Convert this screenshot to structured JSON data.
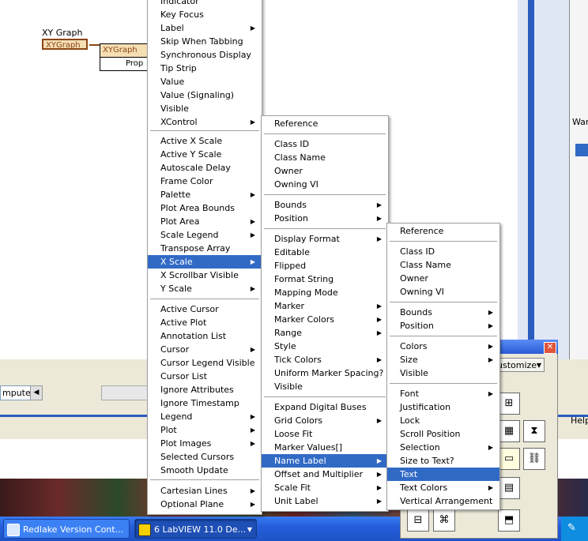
{
  "diagram": {
    "node_label": "XY Graph",
    "terminal_label": "XYGraph",
    "prop_node_top": "XYGraph",
    "prop_node_bottom": "Prop"
  },
  "right_frame": {
    "war_label": "War"
  },
  "lower_strip": {
    "computer_field": "mputer",
    "help_label": "Help"
  },
  "taskbar": {
    "task1": "Redlake Version Cont...",
    "task2": "6 LabVIEW 11.0 De..."
  },
  "palette": {
    "customize_label": "ustomize"
  },
  "menu1": {
    "items": [
      {
        "label": "Indicator",
        "sub": false
      },
      {
        "label": "Key Focus",
        "sub": false
      },
      {
        "label": "Label",
        "sub": true
      },
      {
        "label": "Skip When Tabbing",
        "sub": false
      },
      {
        "label": "Synchronous Display",
        "sub": false
      },
      {
        "label": "Tip Strip",
        "sub": false
      },
      {
        "label": "Value",
        "sub": false
      },
      {
        "label": "Value (Signaling)",
        "sub": false
      },
      {
        "label": "Visible",
        "sub": false
      },
      {
        "label": "XControl",
        "sub": true
      },
      {
        "label": "Active X Scale",
        "sub": false
      },
      {
        "label": "Active Y Scale",
        "sub": false
      },
      {
        "label": "Autoscale Delay",
        "sub": false
      },
      {
        "label": "Frame Color",
        "sub": false
      },
      {
        "label": "Palette",
        "sub": true
      },
      {
        "label": "Plot Area Bounds",
        "sub": false
      },
      {
        "label": "Plot Area",
        "sub": true
      },
      {
        "label": "Scale Legend",
        "sub": true
      },
      {
        "label": "Transpose Array",
        "sub": false
      },
      {
        "label": "X Scale",
        "sub": true
      },
      {
        "label": "X Scrollbar Visible",
        "sub": false
      },
      {
        "label": "Y Scale",
        "sub": true
      },
      {
        "label": "Active Cursor",
        "sub": false
      },
      {
        "label": "Active Plot",
        "sub": false
      },
      {
        "label": "Annotation List",
        "sub": false
      },
      {
        "label": "Cursor",
        "sub": true
      },
      {
        "label": "Cursor Legend Visible",
        "sub": false
      },
      {
        "label": "Cursor List",
        "sub": false
      },
      {
        "label": "Ignore Attributes",
        "sub": false
      },
      {
        "label": "Ignore Timestamp",
        "sub": false
      },
      {
        "label": "Legend",
        "sub": true
      },
      {
        "label": "Plot",
        "sub": true
      },
      {
        "label": "Plot Images",
        "sub": true
      },
      {
        "label": "Selected Cursors",
        "sub": false
      },
      {
        "label": "Smooth Update",
        "sub": false
      },
      {
        "label": "Cartesian Lines",
        "sub": true
      },
      {
        "label": "Optional Plane",
        "sub": true
      }
    ]
  },
  "menu2": {
    "items": [
      {
        "label": "Reference",
        "sub": false
      },
      {
        "label": "Class ID",
        "sub": false
      },
      {
        "label": "Class Name",
        "sub": false
      },
      {
        "label": "Owner",
        "sub": false
      },
      {
        "label": "Owning VI",
        "sub": false
      },
      {
        "label": "Bounds",
        "sub": true
      },
      {
        "label": "Position",
        "sub": true
      },
      {
        "label": "Display Format",
        "sub": true
      },
      {
        "label": "Editable",
        "sub": false
      },
      {
        "label": "Flipped",
        "sub": false
      },
      {
        "label": "Format String",
        "sub": false
      },
      {
        "label": "Mapping Mode",
        "sub": false
      },
      {
        "label": "Marker",
        "sub": true
      },
      {
        "label": "Marker Colors",
        "sub": true
      },
      {
        "label": "Range",
        "sub": true
      },
      {
        "label": "Style",
        "sub": false
      },
      {
        "label": "Tick Colors",
        "sub": true
      },
      {
        "label": "Uniform Marker Spacing?",
        "sub": false
      },
      {
        "label": "Visible",
        "sub": false
      },
      {
        "label": "Expand Digital Buses",
        "sub": false
      },
      {
        "label": "Grid Colors",
        "sub": true
      },
      {
        "label": "Loose Fit",
        "sub": false
      },
      {
        "label": "Marker Values[]",
        "sub": false
      },
      {
        "label": "Name Label",
        "sub": true
      },
      {
        "label": "Offset and Multiplier",
        "sub": true
      },
      {
        "label": "Scale Fit",
        "sub": true
      },
      {
        "label": "Unit Label",
        "sub": true
      }
    ]
  },
  "menu3": {
    "items": [
      {
        "label": "Reference",
        "sub": false
      },
      {
        "label": "Class ID",
        "sub": false
      },
      {
        "label": "Class Name",
        "sub": false
      },
      {
        "label": "Owner",
        "sub": false
      },
      {
        "label": "Owning VI",
        "sub": false
      },
      {
        "label": "Bounds",
        "sub": true
      },
      {
        "label": "Position",
        "sub": true
      },
      {
        "label": "Colors",
        "sub": true
      },
      {
        "label": "Size",
        "sub": true
      },
      {
        "label": "Visible",
        "sub": false
      },
      {
        "label": "Font",
        "sub": true
      },
      {
        "label": "Justification",
        "sub": false
      },
      {
        "label": "Lock",
        "sub": false
      },
      {
        "label": "Scroll Position",
        "sub": false
      },
      {
        "label": "Selection",
        "sub": true
      },
      {
        "label": "Size to Text?",
        "sub": false
      },
      {
        "label": "Text",
        "sub": false
      },
      {
        "label": "Text Colors",
        "sub": true
      },
      {
        "label": "Vertical Arrangement",
        "sub": false
      }
    ]
  },
  "colors": {
    "selection": "#316ac5",
    "terminal": "#8b4513",
    "taskbar": "#245edb"
  }
}
